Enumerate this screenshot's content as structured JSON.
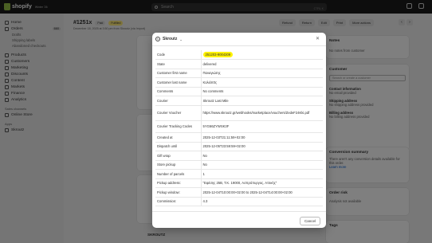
{
  "topbar": {
    "logo": "shopify",
    "logo_badge": "Winter '26",
    "search_placeholder": "Search",
    "search_shortcut": "CTRL K"
  },
  "sidebar": {
    "items": [
      {
        "label": "Home",
        "icon": "home-icon"
      },
      {
        "label": "Orders",
        "icon": "orders-icon",
        "count": "660"
      }
    ],
    "order_sub": [
      "Drafts",
      "Shipping labels",
      "Abandoned checkouts"
    ],
    "items2": [
      {
        "label": "Products",
        "icon": "tag-icon"
      },
      {
        "label": "Customers",
        "icon": "person-icon"
      },
      {
        "label": "Marketing",
        "icon": "target-icon"
      },
      {
        "label": "Discounts",
        "icon": "discount-icon"
      },
      {
        "label": "Content",
        "icon": "content-icon"
      },
      {
        "label": "Markets",
        "icon": "globe-icon"
      },
      {
        "label": "Finance",
        "icon": "bank-icon"
      },
      {
        "label": "Analytics",
        "icon": "chart-icon"
      }
    ],
    "sales_channels_heading": "Sales channels",
    "online_store": "Online Store",
    "apps_heading": "Apps",
    "skroutz": "Skroutz"
  },
  "order": {
    "id": "#1251x",
    "badges": [
      "Paid",
      "Fulfilled"
    ],
    "date": "December 18, 2025 at 3:50 pm from Skroutz (via Import)",
    "actions": [
      "Refund",
      "Return",
      "Edit",
      "Print",
      "More actions"
    ]
  },
  "right_cards": {
    "notes_title": "Notes",
    "notes_text": "No notes from customer",
    "customer_title": "Customer",
    "customer_placeholder": "Search or create a customer",
    "contact_title": "Contact information",
    "contact_text": "No email provided",
    "shipping_title": "Shipping address",
    "shipping_text": "No shipping address provided",
    "billing_title": "Billing address",
    "billing_text": "No billing address provided",
    "conversion_title": "Conversion summary",
    "conversion_text": "There aren't any conversion details available for this order.",
    "learn_more": "Learn more",
    "risk_title": "Order risk",
    "risk_text": "Analysis not available",
    "tags_title": "Tags"
  },
  "bottom": {
    "skroutz_label": "SKROUTZ"
  },
  "modal": {
    "title": "Skroutz",
    "cancel": "Cancel",
    "rows": [
      {
        "key": "Code",
        "value": "251203-9004309",
        "highlight": true
      },
      {
        "key": "State",
        "value": "delivered"
      },
      {
        "key": "Customer first name",
        "value": "Παναγιώτης"
      },
      {
        "key": "Customer last name",
        "value": "Κολιόπ0ς"
      },
      {
        "key": "Comments",
        "value": "No comments"
      },
      {
        "key": "Courier",
        "value": "Skroutz Last Mile"
      },
      {
        "key": "Courier Voucher",
        "value": "https://www.skroutz.gr/webhooks/marketplace/vouchers/ZedeF24Kki.pdf"
      },
      {
        "key": "Courier Tracking Codes",
        "value": "5YG66ZYWSK3F"
      },
      {
        "key": "Created at",
        "value": "2025-12-03T21:11:59+02:00"
      },
      {
        "key": "Dispatch until",
        "value": "2025-12-05T23:59:59+02:00"
      },
      {
        "key": "Gift wrap",
        "value": "No"
      },
      {
        "key": "Store pickup",
        "value": "No"
      },
      {
        "key": "Number of parcels",
        "value": "1"
      },
      {
        "key": "Pickup address:",
        "value": "\"Εφέσης 25Β, Τ.Κ. 19000, Ασπρόπυργος, Αττικής\""
      },
      {
        "key": "Pickup window:",
        "value": "2025-12-04T10:00:00+02:00 to 2025-12-04T14:00:00+02:00"
      },
      {
        "key": "Commission:",
        "value": "4.3"
      }
    ]
  }
}
